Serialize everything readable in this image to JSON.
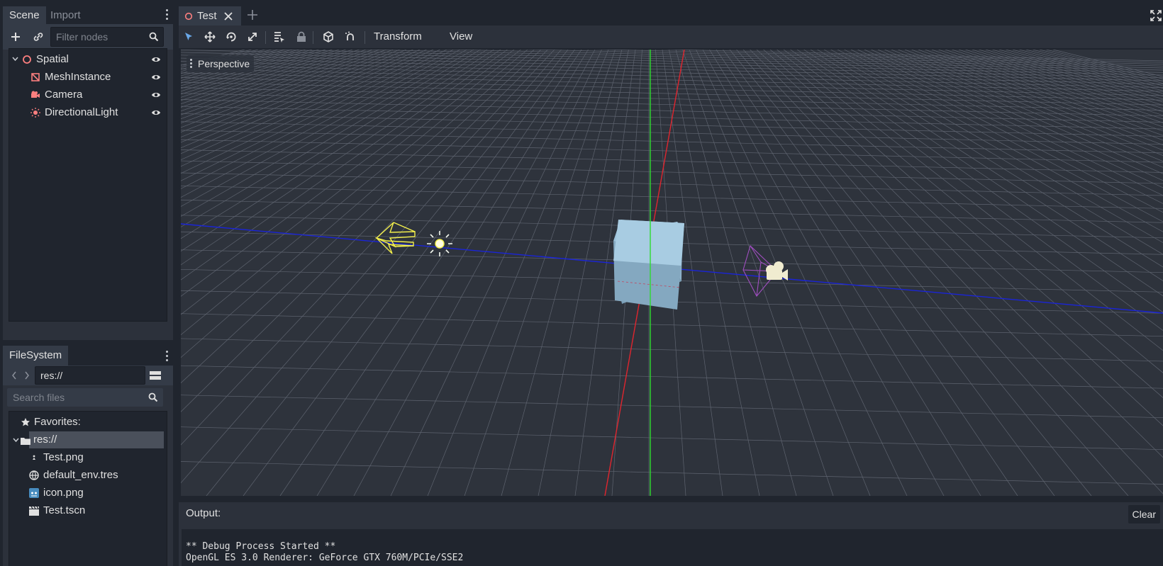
{
  "scene_dock": {
    "tabs": [
      {
        "label": "Scene",
        "active": true
      },
      {
        "label": "Import",
        "active": false
      }
    ],
    "filter_placeholder": "Filter nodes",
    "nodes": [
      {
        "label": "Spatial",
        "icon": "spatial-icon",
        "visible": true
      },
      {
        "label": "MeshInstance",
        "icon": "mesh-instance-icon",
        "visible": true
      },
      {
        "label": "Camera",
        "icon": "camera-icon",
        "visible": true
      },
      {
        "label": "DirectionalLight",
        "icon": "directional-light-icon",
        "visible": true
      }
    ]
  },
  "filesystem_dock": {
    "tab_label": "FileSystem",
    "path": "res://",
    "search_placeholder": "Search files",
    "favorites_label": "Favorites:",
    "root_label": "res://",
    "files": [
      {
        "label": "Test.png",
        "icon": "image-file-icon"
      },
      {
        "label": "default_env.tres",
        "icon": "environment-icon"
      },
      {
        "label": "icon.png",
        "icon": "godot-icon"
      },
      {
        "label": "Test.tscn",
        "icon": "scene-file-icon"
      }
    ]
  },
  "editor": {
    "scene_tab_label": "Test",
    "menus": {
      "transform": "Transform",
      "view": "View"
    },
    "viewport_mode": "Perspective"
  },
  "output": {
    "title": "Output:",
    "clear_label": "Clear",
    "log_lines": [
      "** Debug Process Started **",
      "OpenGL ES 3.0 Renderer: GeForce GTX 760M/PCIe/SSE2"
    ]
  },
  "colors": {
    "accent": "#6aa8e8",
    "x_axis": "#e0252e",
    "y_axis": "#2edc2e",
    "z_axis": "#1a24d8",
    "light_gizmo": "#f4f04c",
    "camera_gizmo": "#a04ec0",
    "cube": "#a4c8e0"
  }
}
